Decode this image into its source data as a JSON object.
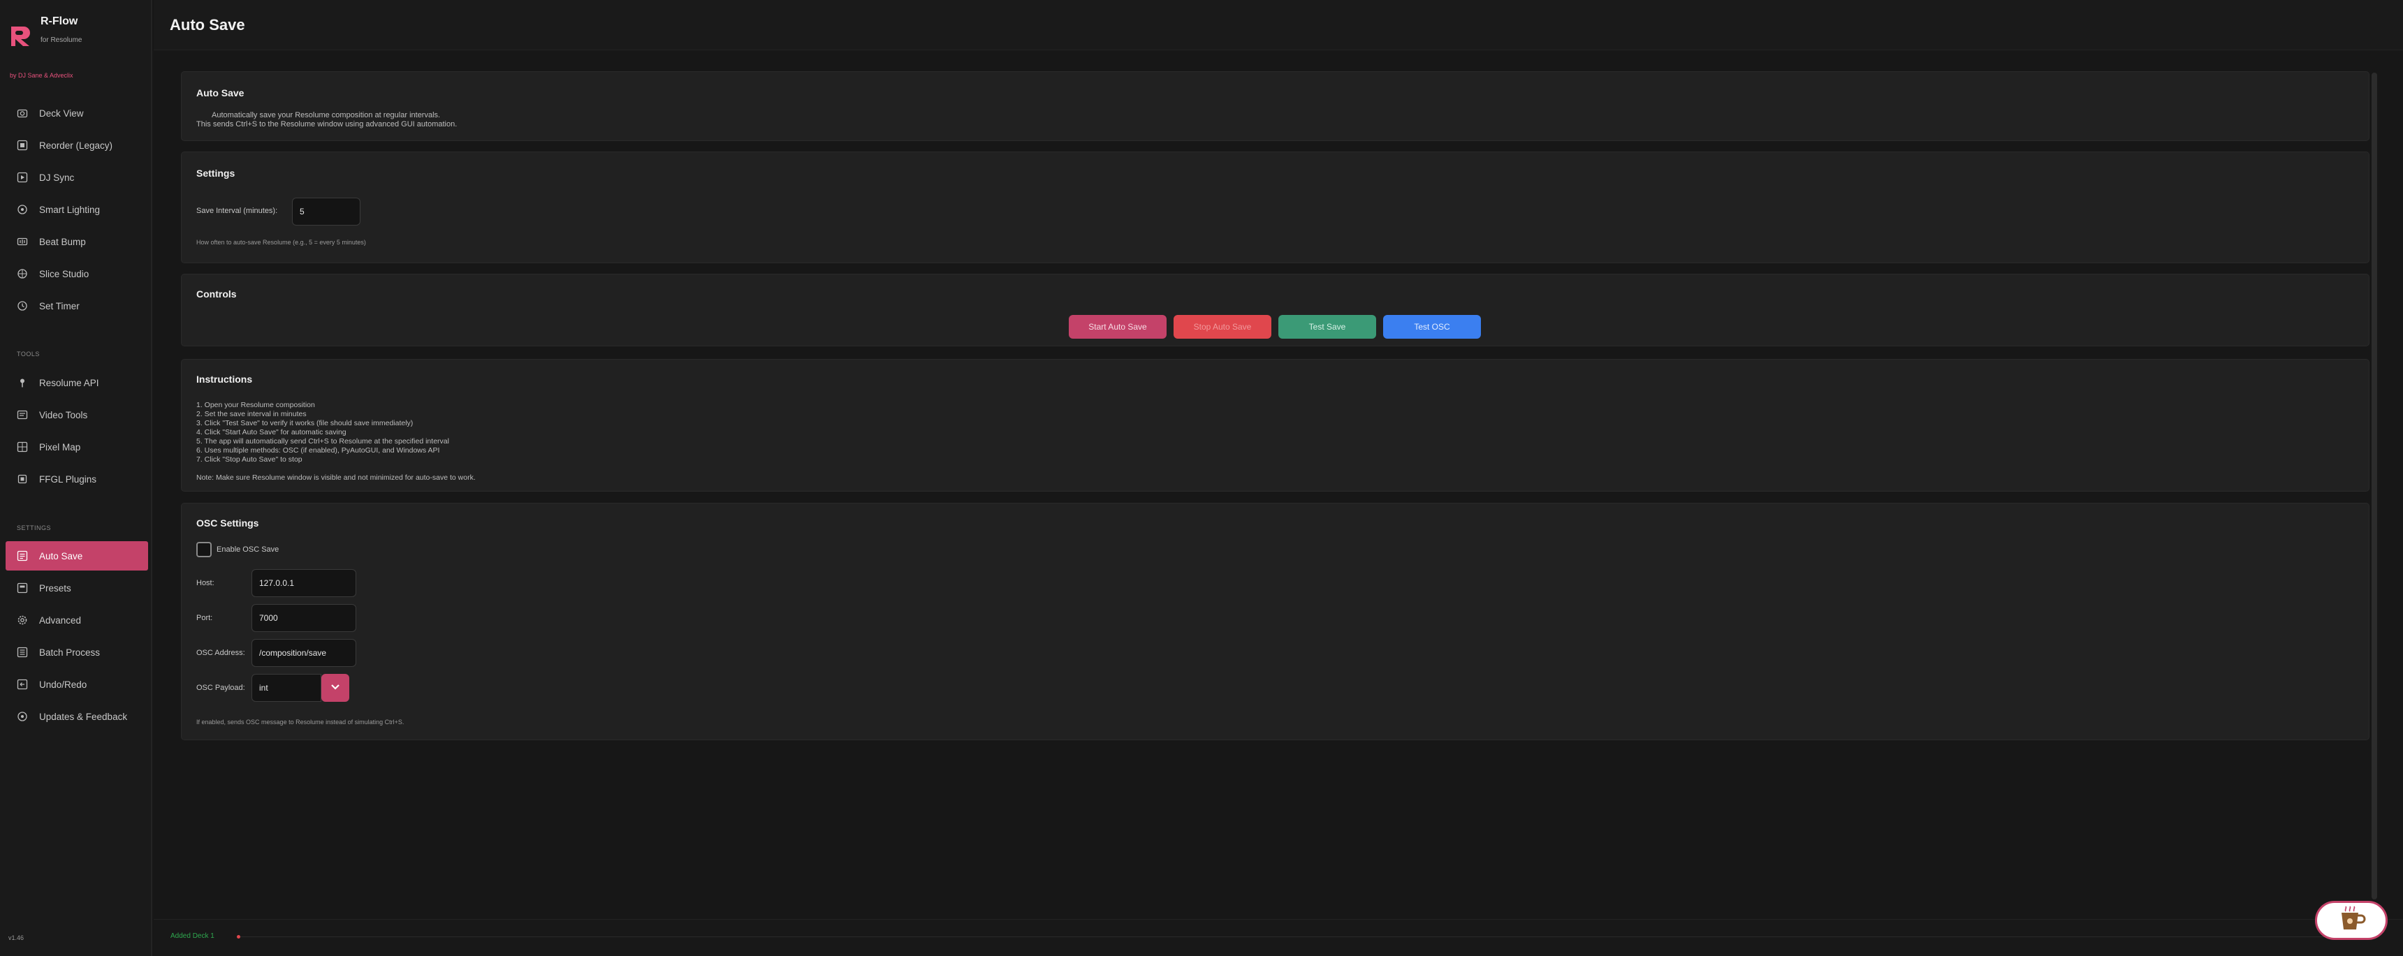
{
  "app": {
    "name": "R-Flow",
    "subtitle": "for Resolume",
    "byline": "by DJ Sane & Adveclix",
    "version": "v1.46"
  },
  "sidebar": {
    "main_items": [
      {
        "label": "Deck View",
        "icon": "camera-icon"
      },
      {
        "label": "Reorder (Legacy)",
        "icon": "record-icon"
      },
      {
        "label": "DJ Sync",
        "icon": "sync-icon"
      },
      {
        "label": "Smart Lighting",
        "icon": "bulb-icon"
      },
      {
        "label": "Beat Bump",
        "icon": "beat-icon"
      },
      {
        "label": "Slice Studio",
        "icon": "slice-icon"
      },
      {
        "label": "Set Timer",
        "icon": "timer-icon"
      }
    ],
    "tools_label": "TOOLS",
    "tools_items": [
      {
        "label": "Resolume API",
        "icon": "pin-icon"
      },
      {
        "label": "Video Tools",
        "icon": "video-icon"
      },
      {
        "label": "Pixel Map",
        "icon": "grid-icon"
      },
      {
        "label": "FFGL Plugins",
        "icon": "plugin-icon"
      }
    ],
    "settings_label": "SETTINGS",
    "settings_items": [
      {
        "label": "Auto Save",
        "icon": "save-icon",
        "active": true
      },
      {
        "label": "Presets",
        "icon": "presets-icon"
      },
      {
        "label": "Advanced",
        "icon": "gear-icon"
      },
      {
        "label": "Batch Process",
        "icon": "batch-icon"
      },
      {
        "label": "Undo/Redo",
        "icon": "undo-icon"
      },
      {
        "label": "Updates & Feedback",
        "icon": "feedback-icon"
      }
    ]
  },
  "header": {
    "title": "Auto Save"
  },
  "intro": {
    "title": "Auto Save",
    "line1": "Automatically save your Resolume composition at regular intervals.",
    "line2": "This sends Ctrl+S to the Resolume window using advanced GUI automation."
  },
  "settings": {
    "title": "Settings",
    "interval_label": "Save Interval (minutes):",
    "interval_value": "5",
    "hint": "How often to auto-save Resolume (e.g., 5 = every 5 minutes)"
  },
  "controls": {
    "title": "Controls",
    "start": "Start Auto Save",
    "stop": "Stop Auto Save",
    "test": "Test Save",
    "test_osc": "Test OSC"
  },
  "instructions": {
    "title": "Instructions",
    "steps": [
      "1. Open your Resolume composition",
      "2. Set the save interval in minutes",
      "3. Click \"Test Save\" to verify it works (file should save immediately)",
      "4. Click \"Start Auto Save\" for automatic saving",
      "5. The app will automatically send Ctrl+S to Resolume at the specified interval",
      "6. Uses multiple methods: OSC (if enabled), PyAutoGUI, and Windows API",
      "7. Click \"Stop Auto Save\" to stop"
    ],
    "note": "Note: Make sure Resolume window is visible and not minimized for auto-save to work."
  },
  "osc": {
    "title": "OSC Settings",
    "enable_label": "Enable OSC Save",
    "enabled": false,
    "host_label": "Host:",
    "host_value": "127.0.0.1",
    "port_label": "Port:",
    "port_value": "7000",
    "address_label": "OSC Address:",
    "address_value": "/composition/save",
    "payload_label": "OSC Payload:",
    "payload_value": "int",
    "hint": "If enabled, sends OSC message to Resolume instead of simulating Ctrl+S."
  },
  "status": {
    "text": "Added Deck 1"
  },
  "colors": {
    "accent": "#c44269",
    "stop": "#e0474d",
    "test": "#3b9a76",
    "osc": "#3b7ff0",
    "status_ok": "#2fa84f"
  }
}
